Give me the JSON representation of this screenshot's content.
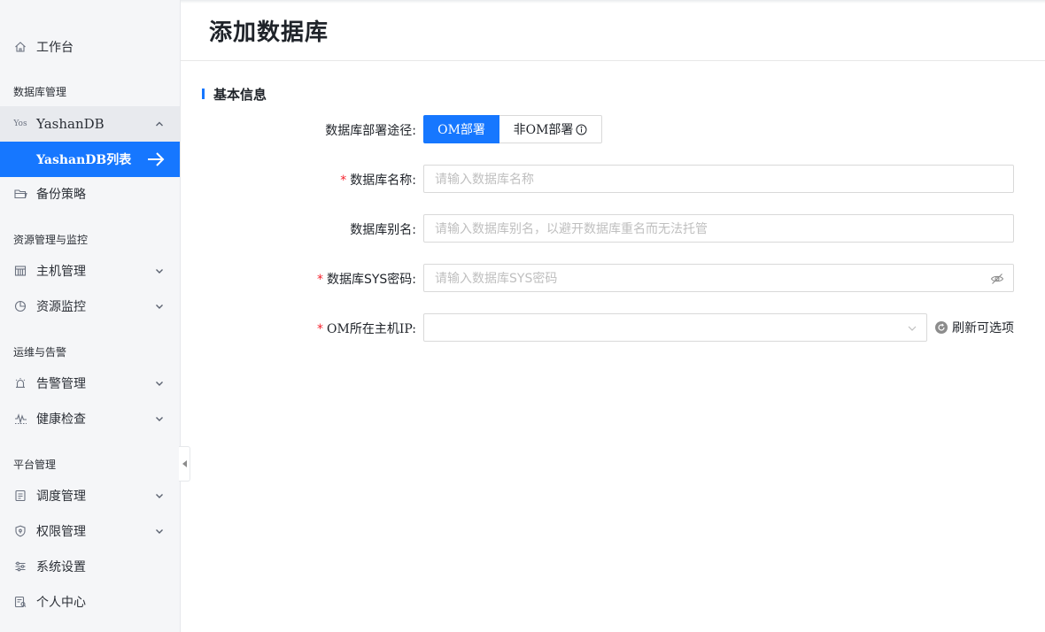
{
  "page": {
    "title": "添加数据库"
  },
  "sidebar": {
    "workbench": {
      "label": "工作台",
      "icon": "home-icon"
    },
    "group_db": "数据库管理",
    "yashandb": {
      "label": "YashanDB",
      "icon_text": "Yos",
      "expanded": true
    },
    "yashandb_list": {
      "label": "YashanDB列表",
      "active": true
    },
    "backup": {
      "label": "备份策略",
      "icon": "folder-icon"
    },
    "group_resource": "资源管理与监控",
    "host_mgmt": {
      "label": "主机管理",
      "icon": "server-icon"
    },
    "resource_monitor": {
      "label": "资源监控",
      "icon": "pie-chart-icon"
    },
    "group_ops": "运维与告警",
    "alarm_mgmt": {
      "label": "告警管理",
      "icon": "alarm-icon"
    },
    "health_check": {
      "label": "健康检查",
      "icon": "pulse-icon"
    },
    "group_platform": "平台管理",
    "schedule_mgmt": {
      "label": "调度管理",
      "icon": "document-icon"
    },
    "permission_mgmt": {
      "label": "权限管理",
      "icon": "shield-icon"
    },
    "system_settings": {
      "label": "系统设置",
      "icon": "sliders-icon"
    },
    "personal_center": {
      "label": "个人中心",
      "icon": "user-card-icon"
    }
  },
  "section": {
    "title": "基本信息"
  },
  "form": {
    "deploy_path": {
      "label": "数据库部署途径:",
      "options": [
        "OM部署",
        "非OM部署"
      ],
      "selected": "OM部署"
    },
    "db_name": {
      "label": "数据库名称:",
      "required": "*",
      "placeholder": "请输入数据库名称",
      "value": ""
    },
    "db_alias": {
      "label": "数据库别名:",
      "placeholder": "请输入数据库别名，以避开数据库重名而无法托管",
      "value": ""
    },
    "sys_password": {
      "label": "数据库SYS密码:",
      "required": "*",
      "placeholder": "请输入数据库SYS密码",
      "value": ""
    },
    "om_host_ip": {
      "label": "OM所在主机IP:",
      "required": "*",
      "value": ""
    },
    "refresh_label": "刷新可选项"
  },
  "colors": {
    "primary": "#1677ff",
    "required": "#f5222d",
    "sidebar_bg": "#f5f6f8"
  }
}
